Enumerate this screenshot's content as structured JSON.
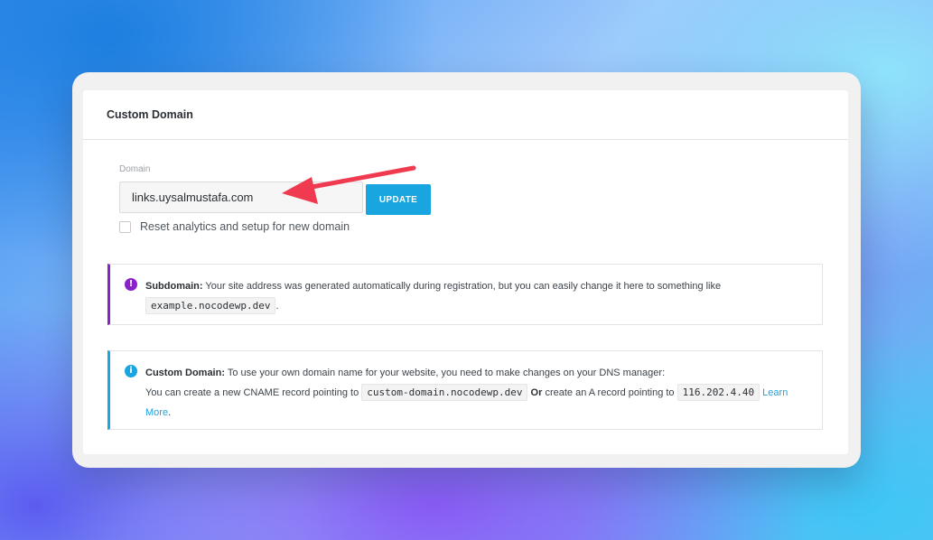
{
  "card": {
    "title": "Custom Domain"
  },
  "domain_field": {
    "label": "Domain",
    "value": "links.uysalmustafa.com"
  },
  "update_button": {
    "label": "UPDATE"
  },
  "reset_option": {
    "label": "Reset analytics and setup for new domain",
    "checked": false
  },
  "subdomain_notice": {
    "icon": "exclamation-icon",
    "title": "Subdomain:",
    "text": "Your site address was generated automatically during registration, but you can easily change it here to something like",
    "example": "example.nocodewp.dev",
    "trailing": "."
  },
  "custom_domain_notice": {
    "icon": "info-icon",
    "title": "Custom Domain:",
    "line1": "To use your own domain name for your website, you need to make changes on your DNS manager:",
    "line2_prefix": "You can create a new CNAME record pointing to",
    "cname_value": "custom-domain.nocodewp.dev",
    "or_label": "Or",
    "a_record_text": "create an A record pointing to",
    "ip_value": "116.202.4.40",
    "learn_more": "Learn More",
    "trailing": "."
  },
  "colors": {
    "accent": "#19a5e0",
    "subdomain_border": "#8b22c9",
    "annotation_arrow": "#f03a4f"
  }
}
